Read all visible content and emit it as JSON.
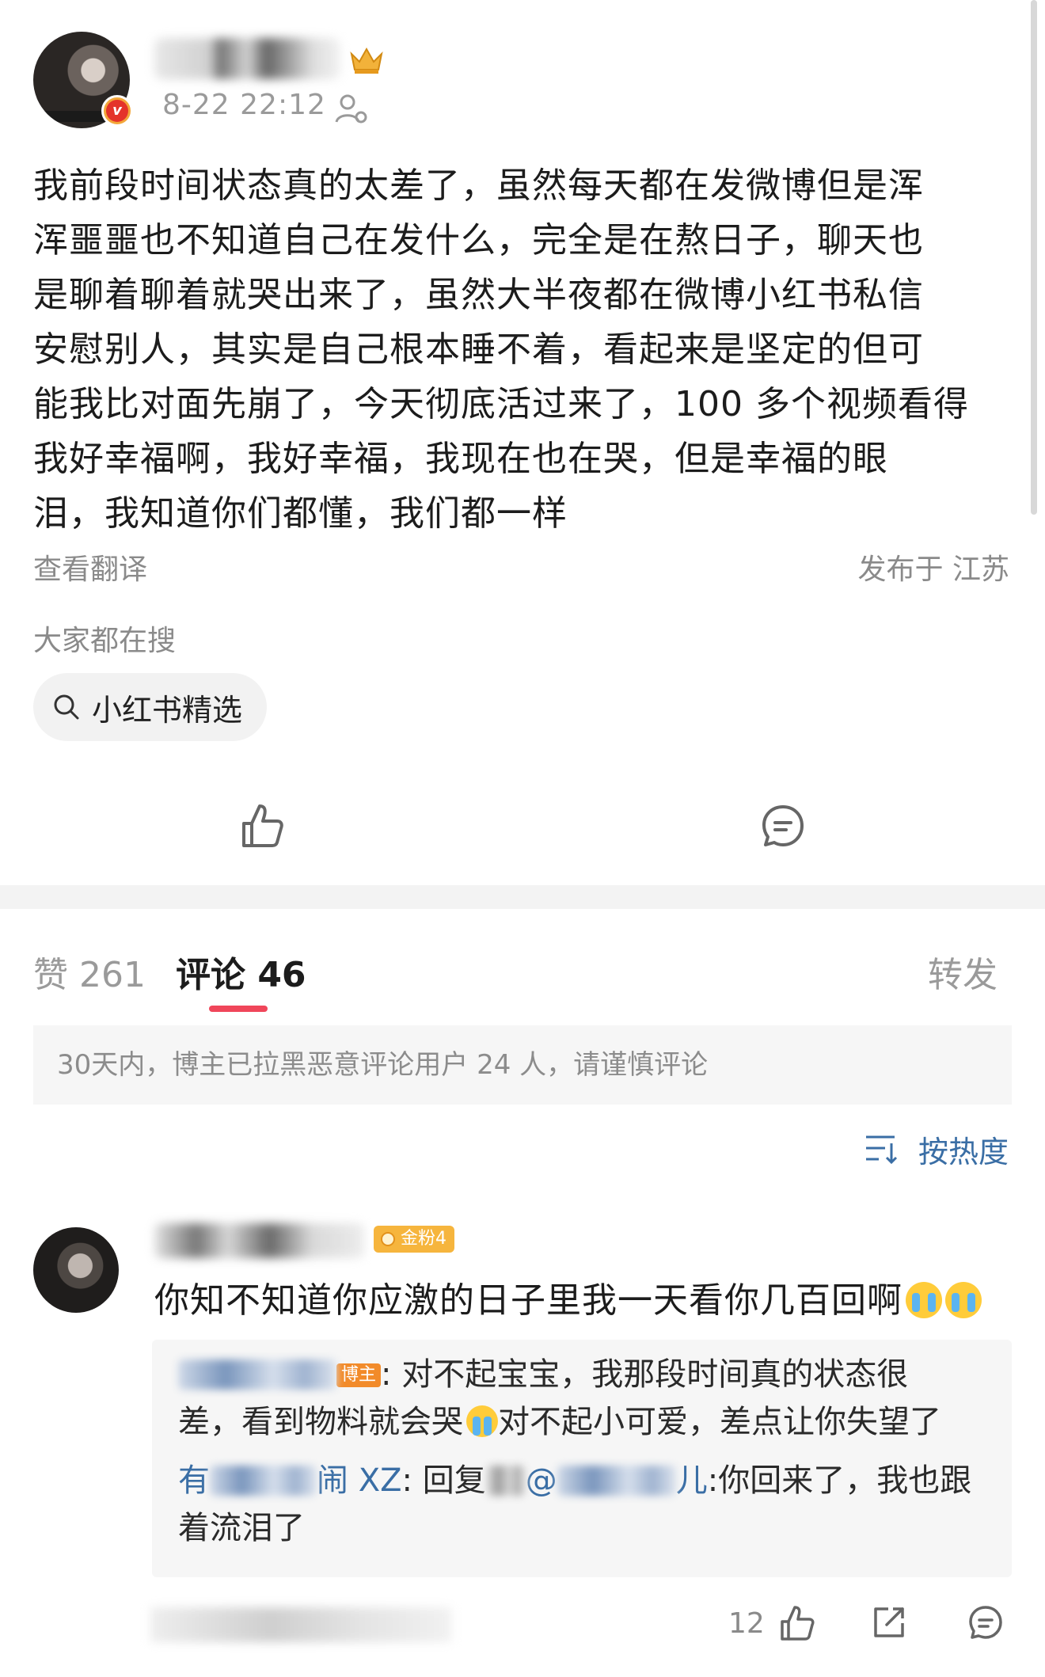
{
  "post": {
    "time": "8-22 22:12",
    "text_lines": [
      "我前段时间状态真的太差了，虽然每天都在发微博但是浑",
      "浑噩噩也不知道自己在发什么，完全是在熬日子，聊天也",
      "是聊着聊着就哭出来了，虽然大半夜都在微博小红书私信",
      "安慰别人，其实是自己根本睡不着，看起来是坚定的但可",
      "能我比对面先崩了，今天彻底活过来了，100 多个视频看得",
      "我好幸福啊，我好幸福，我现在也在哭，但是幸福的眼",
      "泪，我知道你们都懂，我们都一样"
    ],
    "translate_label": "查看翻译",
    "location": "发布于 江苏"
  },
  "search": {
    "title": "大家都在搜",
    "chip_label": "小红书精选"
  },
  "tabs": {
    "likes": "赞 261",
    "comments": "评论 46",
    "repost": "转发"
  },
  "notice": "30天内，博主已拉黑恶意评论用户 24 人，请谨慎评论",
  "sort": {
    "label": "按热度"
  },
  "comment": {
    "fan_badge": "金粉4",
    "text": "你知不知道你应激的日子里我一天看你几百回啊",
    "replies": {
      "r1_badge": "博主",
      "r1_text_a": ": 对不起宝宝，我那段时间真的状态很",
      "r1_text_b_1": "差，看到物料就会哭",
      "r1_text_b_2": "对不起小可爱，差点让你失望了",
      "r2_name_head": "有",
      "r2_name_tail": "闹 XZ",
      "r2_reply_prefix": ": 回复",
      "r2_at": "@",
      "r2_target_tail": "儿",
      "r2_text_a": ":你回来了，我也跟",
      "r2_text_b": "着流泪了"
    },
    "like_count": "12"
  },
  "colors": {
    "accent_red": "#f0465a",
    "link_blue": "#3a6ea5",
    "muted_gray": "#8a8a8a"
  },
  "icons": [
    "verified-v-icon",
    "crown-badge-icon",
    "follow-user-icon",
    "search-icon",
    "thumbs-up-icon",
    "comment-bubble-icon",
    "sort-icon",
    "share-icon",
    "crying-emoji-icon"
  ]
}
